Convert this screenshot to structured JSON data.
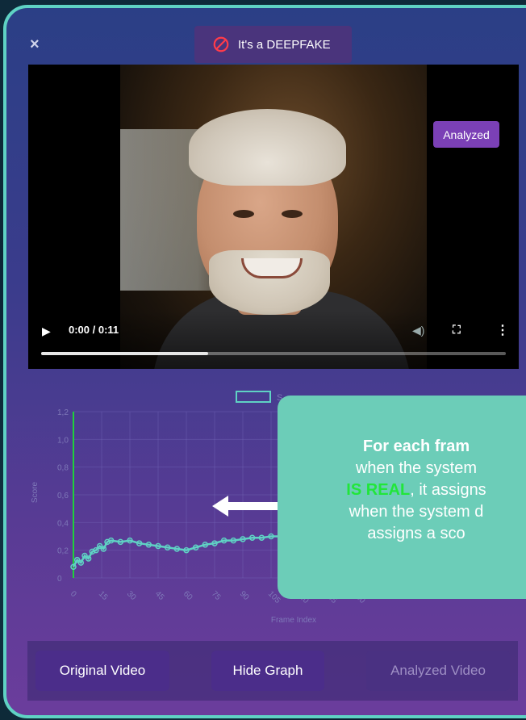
{
  "header": {
    "close_icon": "close-icon",
    "status": {
      "icon": "ban-icon",
      "label": "It's a DEEPFAKE"
    },
    "badge": "Analyzed"
  },
  "video": {
    "time": "0:00 / 0:11",
    "progress": 0.36,
    "icons": [
      "play-icon",
      "volume-icon",
      "fullscreen-icon",
      "more-icon"
    ]
  },
  "chart_data": {
    "type": "line",
    "xlabel": "Frame Index",
    "ylabel": "Score",
    "ylim": [
      0,
      1.2
    ],
    "yticks": [
      "0",
      "0,2",
      "0,4",
      "0,6",
      "0,8",
      "1,0",
      "1,2"
    ],
    "xticks": [
      "0",
      "15",
      "30",
      "45",
      "60",
      "75",
      "90",
      "105",
      "120",
      "135",
      "150"
    ],
    "legend_visible_text": "S",
    "series": [
      {
        "color": "#5fd2c4",
        "x": [
          0,
          2,
          4,
          6,
          8,
          10,
          12,
          14,
          16,
          18,
          20,
          25,
          30,
          35,
          40,
          45,
          50,
          55,
          60,
          65,
          70,
          75,
          80,
          85,
          90,
          95,
          100,
          105,
          110,
          115,
          120,
          125,
          130,
          135,
          140,
          145,
          150,
          155
        ],
        "y": [
          0.08,
          0.13,
          0.11,
          0.16,
          0.14,
          0.19,
          0.2,
          0.23,
          0.21,
          0.26,
          0.27,
          0.26,
          0.27,
          0.25,
          0.24,
          0.23,
          0.22,
          0.21,
          0.2,
          0.22,
          0.24,
          0.25,
          0.27,
          0.27,
          0.28,
          0.29,
          0.29,
          0.3,
          0.3,
          0.31,
          0.31,
          0.32,
          0.32,
          0.32,
          0.31,
          0.31,
          0.3,
          0.3
        ]
      }
    ]
  },
  "callout": {
    "line1": "For each fram",
    "line2": "when the system",
    "line3_green": "IS REAL",
    "line3_rest": ", it assigns",
    "line4": "when the system d",
    "line5": "assigns a sco"
  },
  "buttons": {
    "original": "Original Video",
    "hide_graph": "Hide Graph",
    "analyzed": "Analyzed Video"
  },
  "colors": {
    "accent": "#5fd2c4",
    "button": "#4b2d8a",
    "badge": "#7b40b6",
    "real_green": "#21e63a"
  }
}
